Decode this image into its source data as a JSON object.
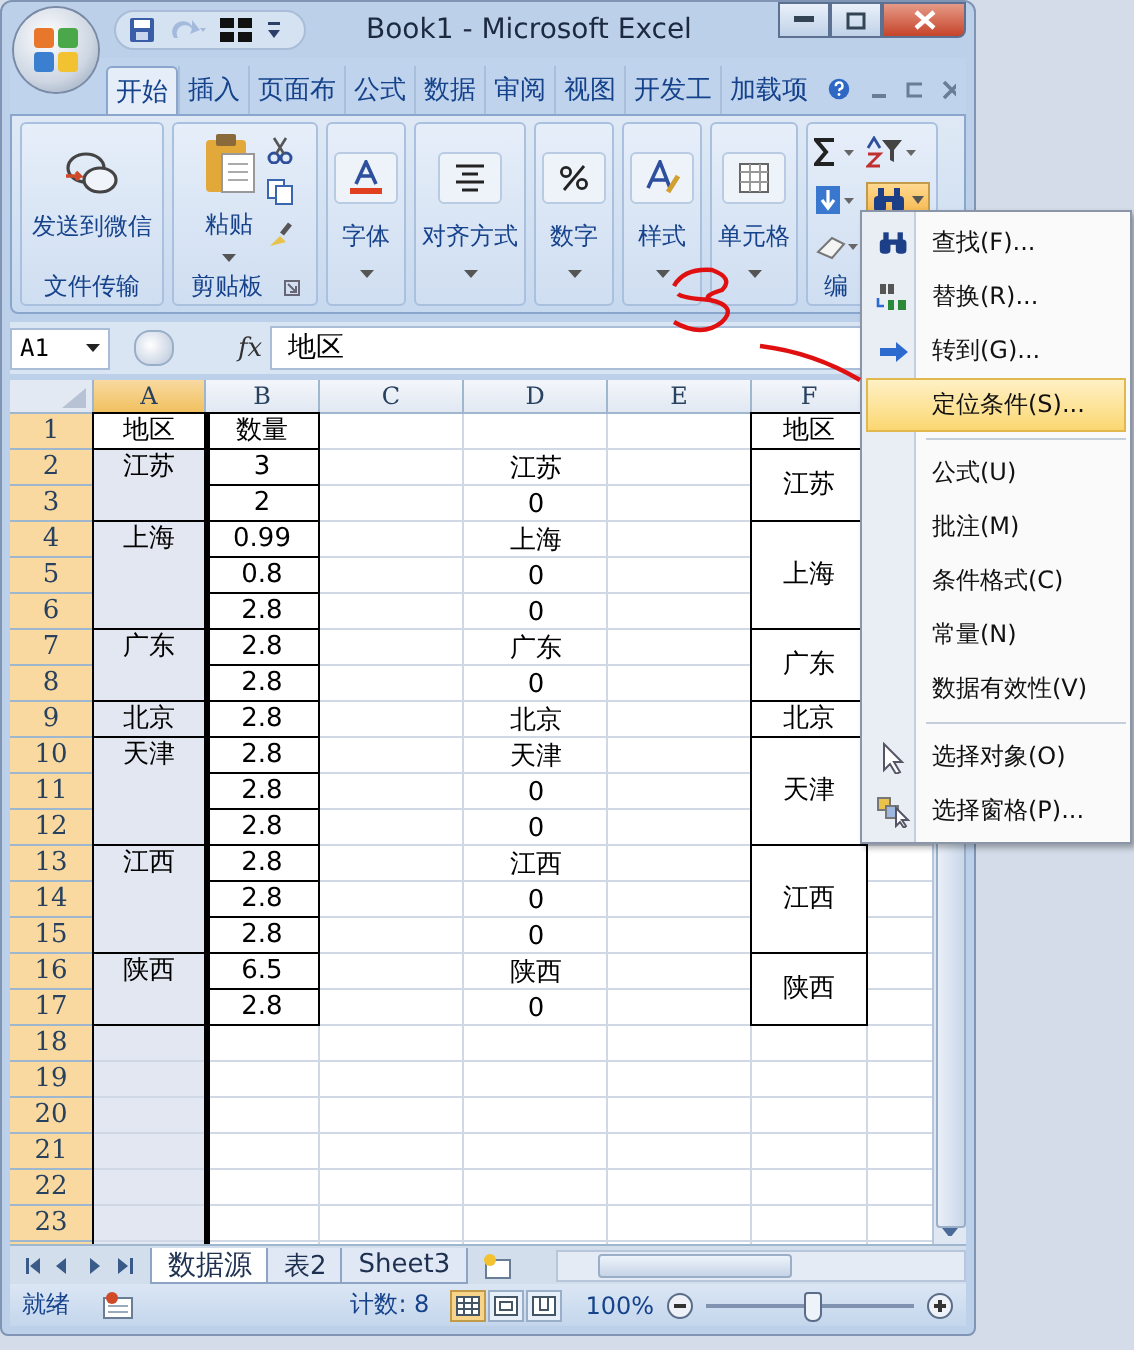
{
  "window": {
    "title": "Book1 - Microsoft Excel"
  },
  "quick_access": [
    {
      "kind": "save",
      "disabled": false
    },
    {
      "kind": "redo",
      "disabled": true
    },
    {
      "kind": "layout",
      "disabled": false
    },
    {
      "kind": "customize",
      "disabled": false
    }
  ],
  "tabs": [
    {
      "label": "开始",
      "selected": true
    },
    {
      "label": "插入",
      "selected": false
    },
    {
      "label": "页面布",
      "selected": false
    },
    {
      "label": "公式",
      "selected": false
    },
    {
      "label": "数据",
      "selected": false
    },
    {
      "label": "审阅",
      "selected": false
    },
    {
      "label": "视图",
      "selected": false
    },
    {
      "label": "开发工",
      "selected": false
    },
    {
      "label": "加载项",
      "selected": false
    }
  ],
  "ribbon": [
    {
      "kind": "wechat",
      "button": "发送到微信",
      "label": "文件传输"
    },
    {
      "kind": "clipboard",
      "button": "粘贴",
      "label": "剪贴板"
    },
    {
      "kind": "font",
      "button": "字体"
    },
    {
      "kind": "align",
      "button": "对齐方式"
    },
    {
      "kind": "number",
      "button": "数字"
    },
    {
      "kind": "styles",
      "button": "样式"
    },
    {
      "kind": "cells",
      "button": "单元格"
    },
    {
      "kind": "editing",
      "label": "编",
      "find_pressed": true
    }
  ],
  "formula_bar": {
    "name_box": "A1",
    "fx": "fx",
    "value": "地区"
  },
  "sheet": {
    "columns": [
      {
        "header": "A",
        "selected": true
      },
      {
        "header": "B",
        "selected": false
      },
      {
        "header": "C",
        "selected": false
      },
      {
        "header": "D",
        "selected": false
      },
      {
        "header": "E",
        "selected": false
      },
      {
        "header": "F",
        "selected": false
      }
    ],
    "rows": [
      {
        "header": "1",
        "selected": true,
        "a": "地区",
        "a_active": true,
        "b": "数量",
        "f": "地区"
      },
      {
        "header": "2",
        "selected": true,
        "a": "江苏",
        "b": "3",
        "d": "江苏",
        "f": "江苏"
      },
      {
        "header": "3",
        "selected": true,
        "b": "2",
        "d": "0"
      },
      {
        "header": "4",
        "selected": true,
        "a": "上海",
        "b": "0.99",
        "d": "上海",
        "f": "上海"
      },
      {
        "header": "5",
        "selected": true,
        "b": "0.8",
        "d": "0"
      },
      {
        "header": "6",
        "selected": true,
        "b": "2.8",
        "d": "0"
      },
      {
        "header": "7",
        "selected": true,
        "a": "广东",
        "b": "2.8",
        "d": "广东",
        "f": "广东"
      },
      {
        "header": "8",
        "selected": true,
        "b": "2.8",
        "d": "0"
      },
      {
        "header": "9",
        "selected": true,
        "a": "北京",
        "b": "2.8",
        "d": "北京",
        "f": "北京"
      },
      {
        "header": "10",
        "selected": true,
        "a": "天津",
        "b": "2.8",
        "d": "天津",
        "f": "天津"
      },
      {
        "header": "11",
        "selected": true,
        "b": "2.8",
        "d": "0"
      },
      {
        "header": "12",
        "selected": true,
        "b": "2.8",
        "d": "0"
      },
      {
        "header": "13",
        "selected": true,
        "a": "江西",
        "b": "2.8",
        "d": "江西",
        "f": "江西"
      },
      {
        "header": "14",
        "selected": true,
        "b": "2.8",
        "d": "0"
      },
      {
        "header": "15",
        "selected": true,
        "b": "2.8",
        "d": "0"
      },
      {
        "header": "16",
        "selected": true,
        "a": "陕西",
        "b": "6.5",
        "d": "陕西",
        "f": "陕西"
      },
      {
        "header": "17",
        "selected": true,
        "b": "2.8",
        "d": "0"
      },
      {
        "header": "18",
        "selected": true
      },
      {
        "header": "19",
        "selected": true
      },
      {
        "header": "20",
        "selected": true
      },
      {
        "header": "21",
        "selected": true
      },
      {
        "header": "22",
        "selected": true
      },
      {
        "header": "23",
        "selected": true
      }
    ]
  },
  "sheet_tabs": [
    {
      "label": "数据源",
      "selected": true
    },
    {
      "label": "表2",
      "selected": false
    },
    {
      "label": "Sheet3",
      "selected": false
    }
  ],
  "status_bar": {
    "mode": "就绪",
    "count": "计数: 8",
    "views": [
      {
        "kind": "normal",
        "selected": true
      },
      {
        "kind": "page_layout",
        "selected": false
      },
      {
        "kind": "page_break",
        "selected": false
      }
    ],
    "zoom": "100%",
    "zoom_slider": {
      "level": 0.5
    }
  },
  "menu": {
    "sections": [
      {
        "items": [
          {
            "label": "查找(F)...",
            "kind": "find",
            "selected": false
          },
          {
            "label": "替换(R)...",
            "kind": "replace",
            "selected": false
          },
          {
            "label": "转到(G)...",
            "kind": "goto",
            "selected": false
          },
          {
            "label": "定位条件(S)...",
            "kind": "plain",
            "selected": true
          }
        ]
      },
      {
        "items": [
          {
            "label": "公式(U)",
            "kind": "plain",
            "selected": false
          },
          {
            "label": "批注(M)",
            "kind": "plain",
            "selected": false
          },
          {
            "label": "条件格式(C)",
            "kind": "plain",
            "selected": false
          },
          {
            "label": "常量(N)",
            "kind": "plain",
            "selected": false
          },
          {
            "label": "数据有效性(V)",
            "kind": "plain",
            "selected": false
          }
        ]
      },
      {
        "items": [
          {
            "label": "选择对象(O)",
            "kind": "select",
            "selected": false
          },
          {
            "label": "选择窗格(P)...",
            "kind": "pane",
            "selected": false
          }
        ]
      }
    ]
  }
}
